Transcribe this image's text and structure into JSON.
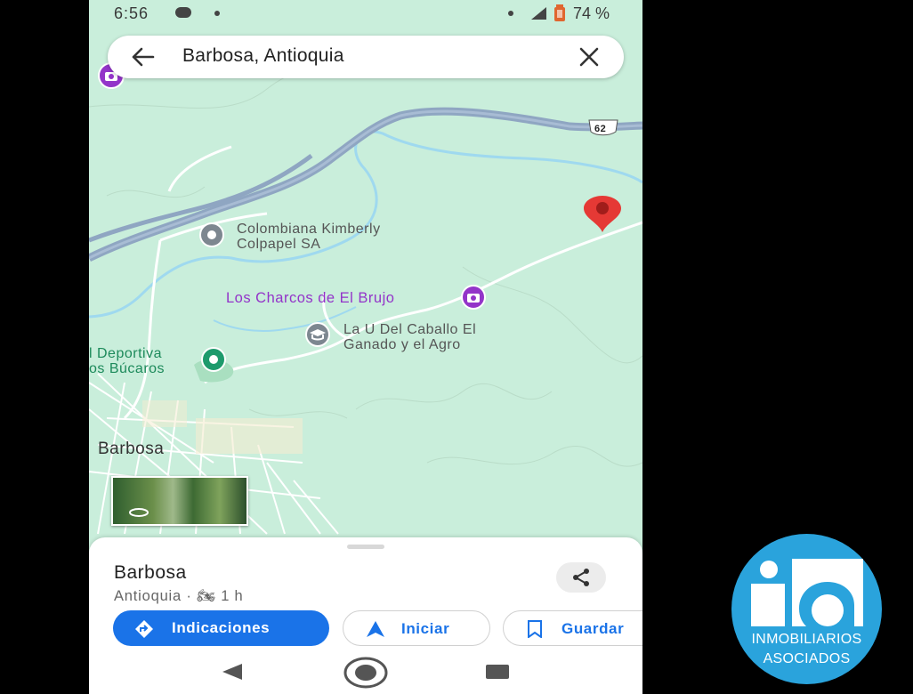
{
  "status_bar": {
    "time": "6:56",
    "battery": "74 %"
  },
  "search": {
    "query": "Barbosa, Antioquia"
  },
  "map": {
    "route_shield": "62",
    "labels": {
      "kimberly": [
        "Colombiana Kimberly",
        "Colpapel SA"
      ],
      "charcos": "Los Charcos de El Brujo",
      "caballo": [
        "La U Del Caballo El",
        "Ganado y el Agro"
      ],
      "deportiva": [
        "l Deportiva",
        "os Búcaros"
      ],
      "town": "Barbosa"
    },
    "colors": {
      "land": "#c9eedb",
      "highway": "#8fa6c2",
      "water": "#9fd9ef",
      "poi_purple": "#9334c9",
      "poi_gray": "#7d8790",
      "poi_green": "#1d9a6c",
      "pin": "#e53935"
    }
  },
  "sheet": {
    "place_name": "Barbosa",
    "subtitle": "Antioquia · 🏍 1 h",
    "buttons": {
      "directions": "Indicaciones",
      "start": "Iniciar",
      "save": "Guardar"
    }
  },
  "logo": {
    "line1": "INMOBILIARIOS",
    "line2": "ASOCIADOS"
  },
  "icons": [
    "chat-icon",
    "signal-icon",
    "battery-icon",
    "back-arrow-icon",
    "close-icon",
    "location-pin-icon",
    "camera-poi-icon",
    "factory-poi-icon",
    "school-poi-icon",
    "sports-poi-icon",
    "share-icon",
    "directions-icon",
    "navigation-icon",
    "bookmark-icon",
    "nav-back-icon",
    "nav-home-icon",
    "nav-recents-icon"
  ]
}
